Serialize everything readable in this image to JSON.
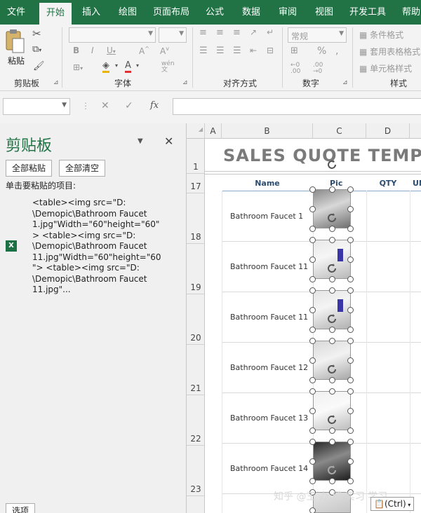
{
  "tabs": [
    "文件",
    "开始",
    "插入",
    "绘图",
    "页面布局",
    "公式",
    "数据",
    "审阅",
    "视图",
    "开发工具",
    "帮助"
  ],
  "ribbon": {
    "paste_label": "粘贴",
    "group_clipboard": "剪贴板",
    "group_font": "字体",
    "group_align": "对齐方式",
    "group_number": "数字",
    "group_style": "样式",
    "number_format": "常规",
    "cond_format": "条件格式",
    "table_format": "套用表格格式",
    "cell_style": "单元格样式",
    "wen_label": "wén",
    "fx": "fx"
  },
  "pane": {
    "title": "剪贴板",
    "paste_all": "全部粘贴",
    "clear_all": "全部清空",
    "hint": "单击要粘贴的项目:",
    "item_text": "<table><img src=\"D:\n\\Demopic\\Bathroom Faucet\n1.jpg\"Width=\"60\"height=\"60\"\n> <table><img src=\"D:\n\\Demopic\\Bathroom Faucet\n11.jpg\"Width=\"60\"height=\"60\n\"> <table><img src=\"D:\n\\Demopic\\Bathroom Faucet\n11.jpg\"...",
    "options": "选项"
  },
  "sheet": {
    "columns": [
      "A",
      "B",
      "C",
      "D"
    ],
    "title": "SALES QUOTE TEMPLATE",
    "headers": {
      "name": "Name",
      "pic": "Pic",
      "qty": "QTY",
      "un": "UN"
    },
    "rows": [
      {
        "num": "1"
      },
      {
        "num": "17"
      },
      {
        "num": "18",
        "name": "Bathroom Faucet 1"
      },
      {
        "num": "19",
        "name": "Bathroom Faucet 11"
      },
      {
        "num": "20",
        "name": "Bathroom Faucet 11"
      },
      {
        "num": "21",
        "name": "Bathroom Faucet 12"
      },
      {
        "num": "22",
        "name": "Bathroom Faucet 13"
      },
      {
        "num": "23",
        "name": "Bathroom Faucet 14"
      }
    ]
  },
  "watermark": "知乎 @王 办 贸 实习 学习",
  "ctrl_tag": "(Ctrl)"
}
